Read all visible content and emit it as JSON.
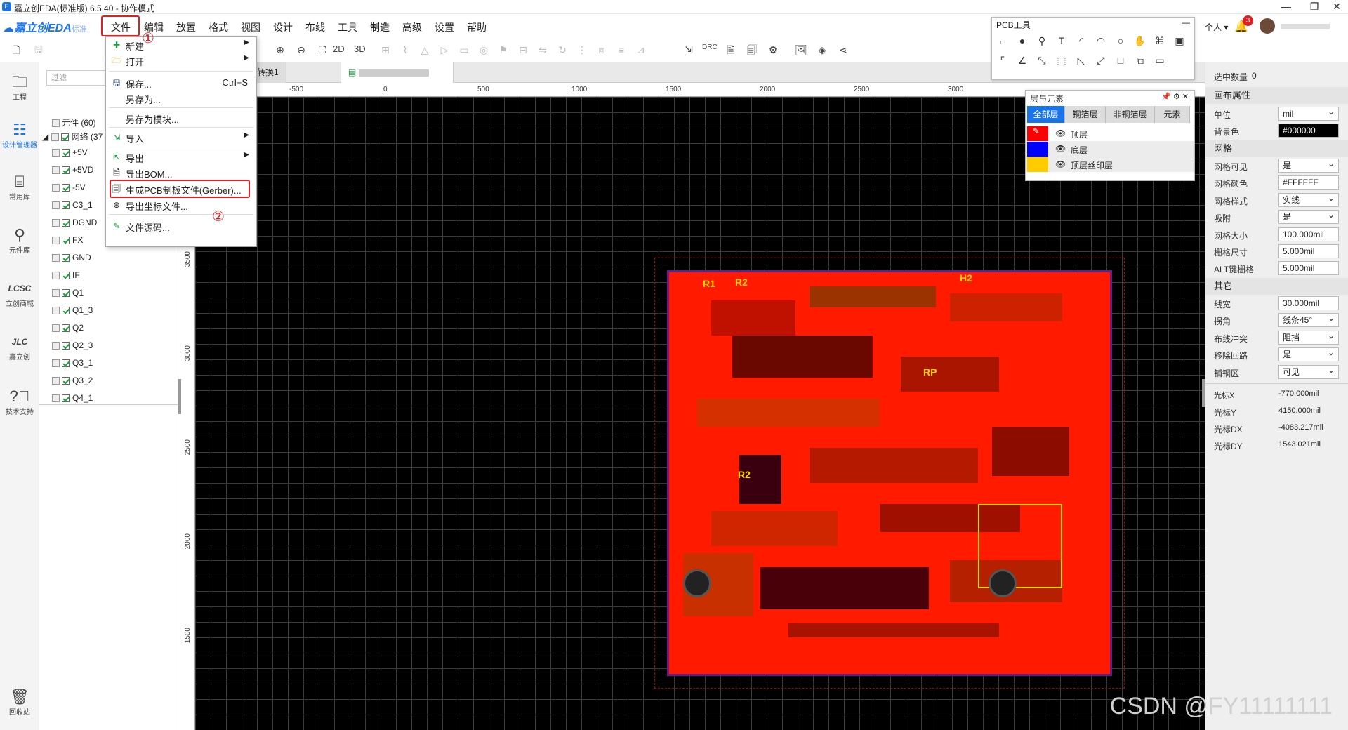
{
  "window": {
    "title": "嘉立创EDA(标准版) 6.5.40 - 协作模式",
    "min": "—",
    "max": "❐",
    "close": "✕"
  },
  "logo": {
    "brand": "嘉立创EDA",
    "edition": "标准"
  },
  "menus": [
    "文件",
    "编辑",
    "放置",
    "格式",
    "视图",
    "设计",
    "布线",
    "工具",
    "制造",
    "高级",
    "设置",
    "帮助"
  ],
  "user": {
    "label": "个人",
    "badge": "3"
  },
  "toolbar": {
    "label_2d": "2D",
    "label_3d": "3D",
    "label_drc": "DRC"
  },
  "leftnav": [
    {
      "label": "工程",
      "icon": "folder-icon"
    },
    {
      "label": "设计管理器",
      "icon": "tree-icon"
    },
    {
      "label": "常用库",
      "icon": "chip-icon"
    },
    {
      "label": "元件库",
      "icon": "search-icon"
    },
    {
      "label": "立创商城",
      "icon": "lcsc-icon"
    },
    {
      "label": "嘉立创",
      "icon": "jlc-icon"
    },
    {
      "label": "技术支持",
      "icon": "help-icon"
    },
    {
      "label": "回收站",
      "icon": "trash-icon"
    }
  ],
  "tree": {
    "filter_placeholder": "过滤",
    "components": "元件 (60)",
    "nets": "网络 (37",
    "items": [
      "+5V",
      "+5VD",
      "-5V",
      "C3_1",
      "DGND",
      "FX",
      "GND",
      "IF",
      "Q1",
      "Q1_3",
      "Q2",
      "Q2_3",
      "Q3_1",
      "Q3_2",
      "Q4_1"
    ]
  },
  "tabs": [
    "转换1",
    ""
  ],
  "ruler": {
    "top": [
      "-500",
      "0",
      "500",
      "1000",
      "1500",
      "2000",
      "2500",
      "3000"
    ],
    "left": [
      "3500",
      "3000",
      "2500",
      "2000",
      "1500"
    ]
  },
  "board": {
    "silk": [
      "R1",
      "R2",
      "H2",
      "RP",
      "R2"
    ]
  },
  "file_menu": {
    "items": [
      {
        "label": "新建",
        "icon": "new-icon",
        "arrow": true
      },
      {
        "label": "打开",
        "icon": "open-folder-icon",
        "arrow": true
      },
      {
        "label": "保存...",
        "icon": "save-icon",
        "shortcut": "Ctrl+S"
      },
      {
        "label": "另存为...",
        "icon": ""
      },
      {
        "label": "另存为模块...",
        "icon": ""
      },
      {
        "label": "导入",
        "icon": "import-icon",
        "arrow": true
      },
      {
        "label": "导出",
        "icon": "export-icon",
        "arrow": true
      },
      {
        "label": "导出BOM...",
        "icon": "bom-icon"
      },
      {
        "label": "生成PCB制板文件(Gerber)...",
        "icon": "gerber-icon"
      },
      {
        "label": "导出坐标文件...",
        "icon": "coordinate-icon"
      },
      {
        "label": "文件源码...",
        "icon": "source-icon"
      }
    ],
    "annotations": [
      "①",
      "②"
    ]
  },
  "pcb_tools": {
    "title": "PCB工具",
    "close": "—"
  },
  "layers": {
    "title": "层与元素",
    "tabs": [
      "全部层",
      "铜箔层",
      "非铜箔层",
      "元素"
    ],
    "rows": [
      {
        "name": "顶层",
        "color": "#ff0000"
      },
      {
        "name": "底层",
        "color": "#0000ff"
      },
      {
        "name": "顶层丝印层",
        "color": "#ffcc00"
      }
    ]
  },
  "right_panel": {
    "selected_label": "选中数量",
    "selected_value": "0",
    "canvas_props": "画布属性",
    "unit_label": "单位",
    "unit_value": "mil",
    "bg_label": "背景色",
    "bg_value": "#000000",
    "grid_section": "网格",
    "grid_visible_label": "网格可见",
    "grid_visible_value": "是",
    "grid_color_label": "网格颜色",
    "grid_color_value": "#FFFFFF",
    "grid_style_label": "网格样式",
    "grid_style_value": "实线",
    "snap_label": "吸附",
    "snap_value": "是",
    "grid_size_label": "网格大小",
    "grid_size_value": "100.000mil",
    "snap_size_label": "栅格尺寸",
    "snap_size_value": "5.000mil",
    "alt_snap_label": "ALT键栅格",
    "alt_snap_value": "5.000mil",
    "other_section": "其它",
    "line_width_label": "线宽",
    "line_width_value": "30.000mil",
    "corner_label": "拐角",
    "corner_value": "线条45°",
    "route_conflict_label": "布线冲突",
    "route_conflict_value": "阻挡",
    "remove_loop_label": "移除回路",
    "remove_loop_value": "是",
    "copper_label": "铺铜区",
    "copper_value": "可见",
    "cursor_x_label": "光标X",
    "cursor_x_value": "-770.000mil",
    "cursor_y_label": "光标Y",
    "cursor_y_value": "4150.000mil",
    "cursor_dx_label": "光标DX",
    "cursor_dx_value": "-4083.217mil",
    "cursor_dy_label": "光标DY",
    "cursor_dy_value": "1543.021mil"
  },
  "watermark": "CSDN @FY11111111"
}
